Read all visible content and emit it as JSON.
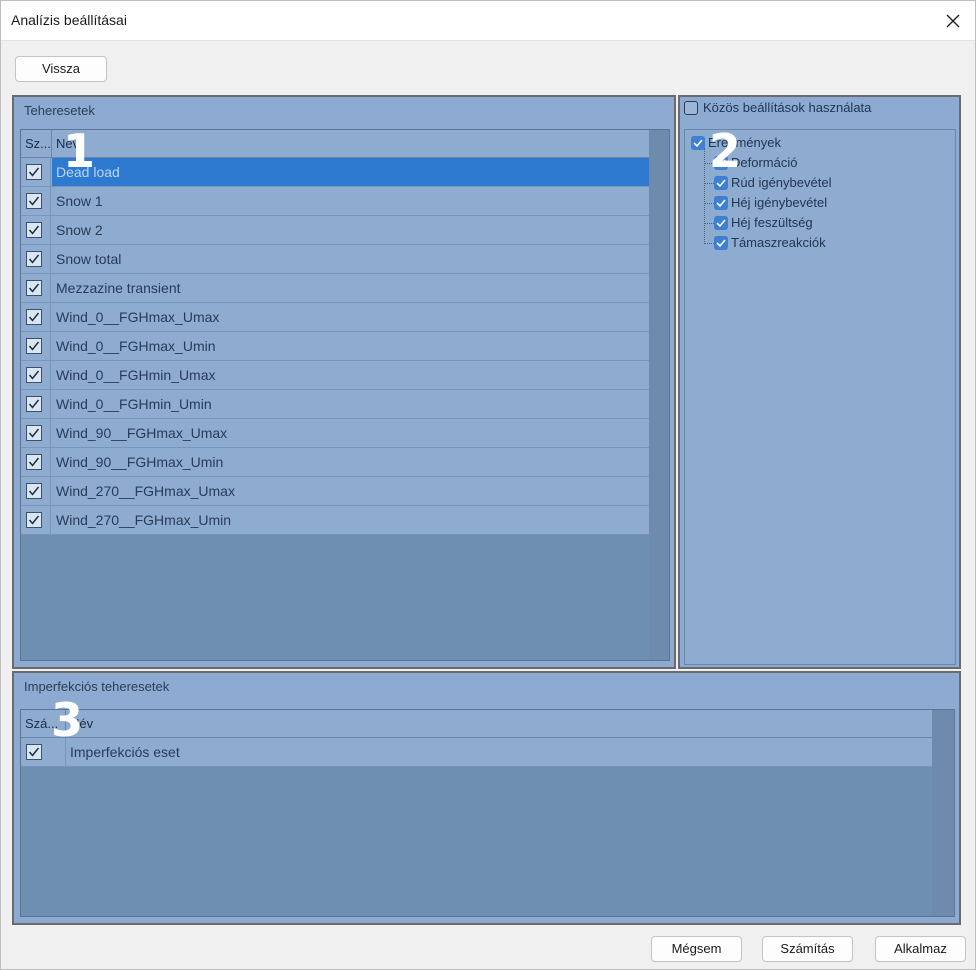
{
  "window": {
    "title": "Analízis beállításai"
  },
  "toolbar": {
    "back_label": "Vissza"
  },
  "loadcases": {
    "title": "Teheresetek",
    "columns": [
      "Sz...",
      "Név"
    ],
    "rows": [
      {
        "name": "Dead load",
        "checked": true,
        "selected": true
      },
      {
        "name": "Snow 1",
        "checked": true
      },
      {
        "name": "Snow 2",
        "checked": true
      },
      {
        "name": "Snow total",
        "checked": true
      },
      {
        "name": "Mezzazine transient",
        "checked": true
      },
      {
        "name": "Wind_0__FGHmax_Umax",
        "checked": true
      },
      {
        "name": "Wind_0__FGHmax_Umin",
        "checked": true
      },
      {
        "name": "Wind_0__FGHmin_Umax",
        "checked": true
      },
      {
        "name": "Wind_0__FGHmin_Umin",
        "checked": true
      },
      {
        "name": "Wind_90__FGHmax_Umax",
        "checked": true
      },
      {
        "name": "Wind_90__FGHmax_Umin",
        "checked": true
      },
      {
        "name": "Wind_270__FGHmax_Umax",
        "checked": true
      },
      {
        "name": "Wind_270__FGHmax_Umin",
        "checked": true
      }
    ]
  },
  "results": {
    "common_settings_label": "Közös beállítások használata",
    "common_settings_checked": false,
    "root": {
      "label": "Eredmények",
      "checked": true
    },
    "children": [
      {
        "label": "Deformáció",
        "checked": true
      },
      {
        "label": "Rúd igénybevétel",
        "checked": true
      },
      {
        "label": "Héj igénybevétel",
        "checked": true
      },
      {
        "label": "Héj feszültség",
        "checked": true
      },
      {
        "label": "Támaszreakciók",
        "checked": true
      }
    ]
  },
  "imperfections": {
    "title": "Imperfekciós teheresetek",
    "columns": [
      "Szá...",
      "Név"
    ],
    "rows": [
      {
        "name": "Imperfekciós eset",
        "checked": true
      }
    ]
  },
  "overlay_numbers": [
    "1",
    "2",
    "3"
  ],
  "footer": {
    "cancel_label": "Mégsem",
    "calculate_label": "Számítás",
    "apply_label": "Alkalmaz"
  },
  "colors": {
    "panel_bg": "#8dabd2",
    "grid_bg": "#6f8fb2",
    "selection": "#2d7ad0",
    "checkbox_blue": "#3d7fd0"
  }
}
